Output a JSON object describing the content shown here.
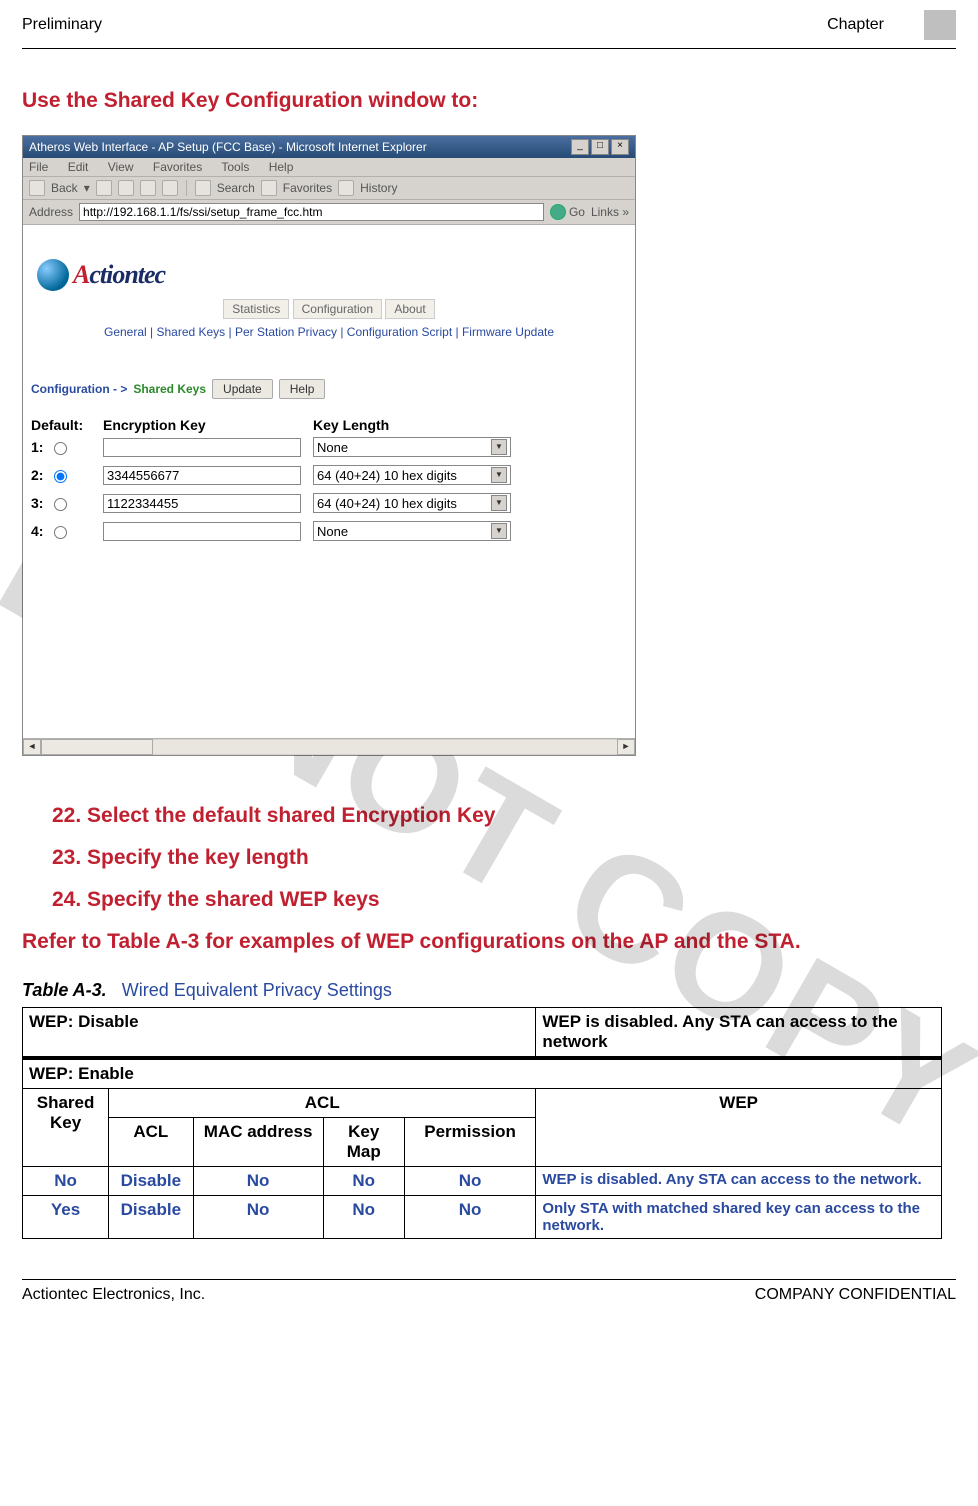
{
  "header": {
    "left": "Preliminary",
    "right": "Chapter"
  },
  "section_title": "Use the Shared Key Configuration window to:",
  "ie": {
    "title": "Atheros Web Interface - AP Setup (FCC Base) - Microsoft Internet Explorer",
    "menu": [
      "File",
      "Edit",
      "View",
      "Favorites",
      "Tools",
      "Help"
    ],
    "toolbar": {
      "back": "Back",
      "search": "Search",
      "favorites": "Favorites",
      "history": "History"
    },
    "address_label": "Address",
    "address_value": "http://192.168.1.1/fs/ssi/setup_frame_fcc.htm",
    "go": "Go",
    "links": "Links",
    "brand": "Actiontec",
    "tabs": [
      "Statistics",
      "Configuration",
      "About"
    ],
    "subtabs": "General | Shared Keys | Per Station Privacy | Configuration Script | Firmware Update",
    "cfg_prefix": "Configuration - >",
    "cfg_section": "Shared Keys",
    "btn_update": "Update",
    "btn_help": "Help",
    "keys_header": {
      "default": "Default:",
      "enc": "Encryption Key",
      "len": "Key Length"
    },
    "rows": [
      {
        "n": "1:",
        "value": "",
        "len": "None",
        "selected": false
      },
      {
        "n": "2:",
        "value": "3344556677",
        "len": "64 (40+24) 10 hex digits",
        "selected": true
      },
      {
        "n": "3:",
        "value": "1122334455",
        "len": "64 (40+24) 10 hex digits",
        "selected": false
      },
      {
        "n": "4:",
        "value": "",
        "len": "None",
        "selected": false
      }
    ]
  },
  "steps": [
    "22. Select the default shared Encryption Key",
    "23. Specify the key length",
    "24. Specify the shared WEP keys"
  ],
  "refer": "Refer to Table A-3 for examples of WEP configurations on the AP and the STA.",
  "table": {
    "caption_label": "Table A-3.",
    "caption_text": "Wired Equivalent Privacy Settings",
    "row_disable_label": "WEP: Disable",
    "row_disable_desc": "WEP is disabled. Any STA can access to the network",
    "row_enable_label": "WEP: Enable",
    "headers": {
      "shared_key": "Shared Key",
      "acl_group": "ACL",
      "acl": "ACL",
      "mac": "MAC address",
      "keymap": "Key Map",
      "permission": "Permission",
      "wep": "WEP"
    },
    "rows": [
      {
        "shared": "No",
        "acl": "Disable",
        "mac": "No",
        "keymap": "No",
        "permission": "No",
        "wep": "WEP is disabled. Any STA can access to the network."
      },
      {
        "shared": "Yes",
        "acl": "Disable",
        "mac": "No",
        "keymap": "No",
        "permission": "No",
        "wep": "Only STA with matched shared key can access to the network."
      }
    ]
  },
  "footer": {
    "left": "Actiontec Electronics, Inc.",
    "right": "COMPANY CONFIDENTIAL"
  },
  "watermark": "DO NOT COPY"
}
